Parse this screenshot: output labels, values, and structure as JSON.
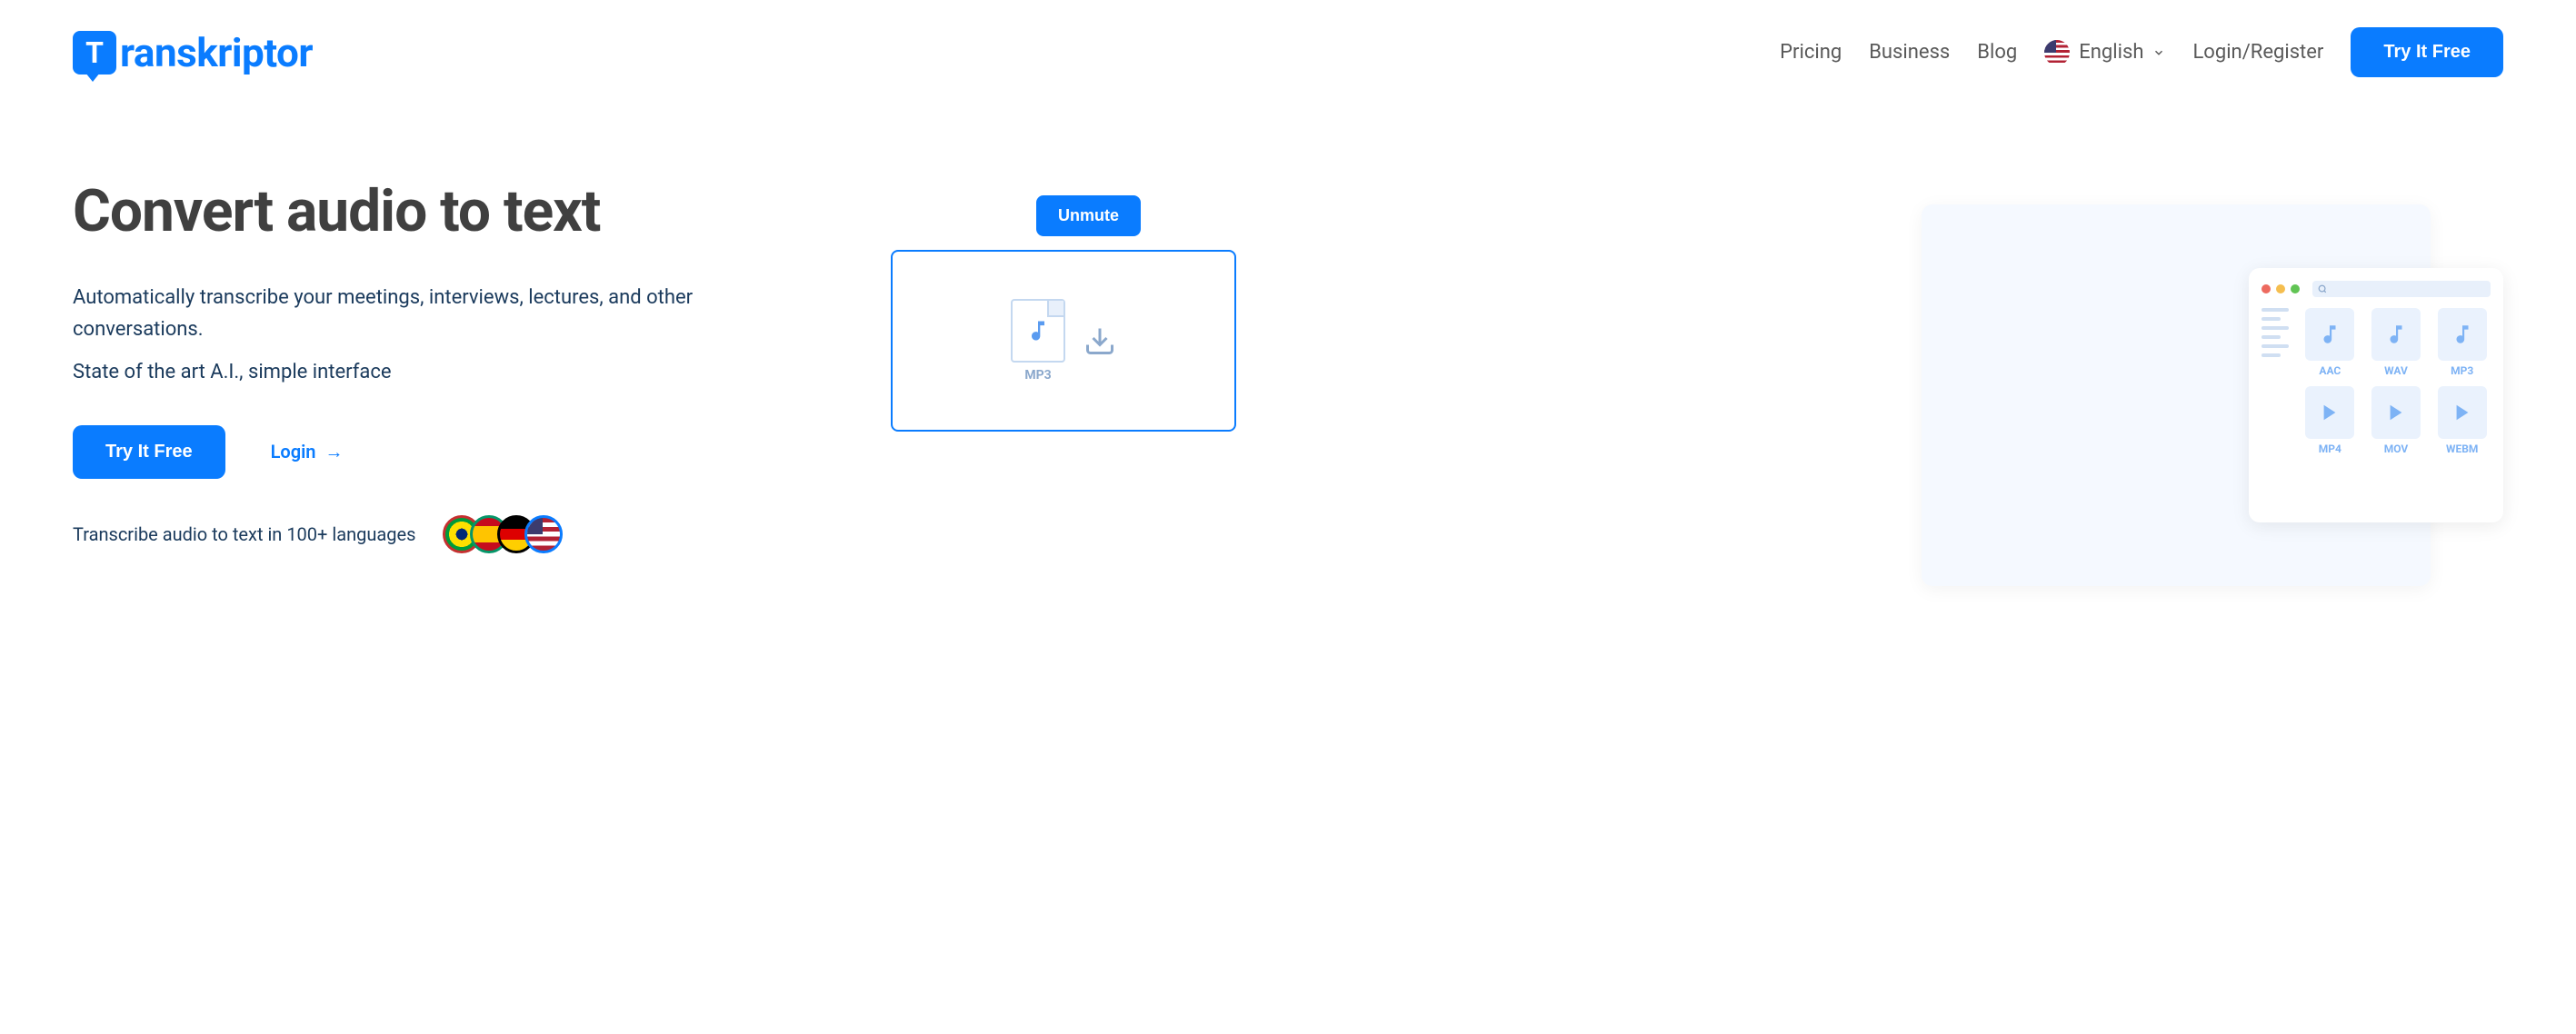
{
  "brand": {
    "name": "ranskriptor",
    "logo_letter": "T"
  },
  "nav": {
    "pricing": "Pricing",
    "business": "Business",
    "blog": "Blog",
    "language": "English",
    "login_register": "Login/Register",
    "try_free": "Try It Free"
  },
  "hero": {
    "title": "Convert audio to text",
    "desc1": "Automatically transcribe your meetings, interviews, lectures, and other conversations.",
    "desc2": "State of the art A.I., simple interface",
    "try_free": "Try It Free",
    "login": "Login",
    "languages_text": "Transcribe audio to text in 100+ languages"
  },
  "demo": {
    "unmute": "Unmute",
    "mp3_label": "MP3",
    "files": [
      {
        "type": "AAC",
        "icon": "music"
      },
      {
        "type": "WAV",
        "icon": "music"
      },
      {
        "type": "MP3",
        "icon": "music"
      },
      {
        "type": "MP4",
        "icon": "video"
      },
      {
        "type": "MOV",
        "icon": "video"
      },
      {
        "type": "WEBM",
        "icon": "video"
      }
    ]
  }
}
